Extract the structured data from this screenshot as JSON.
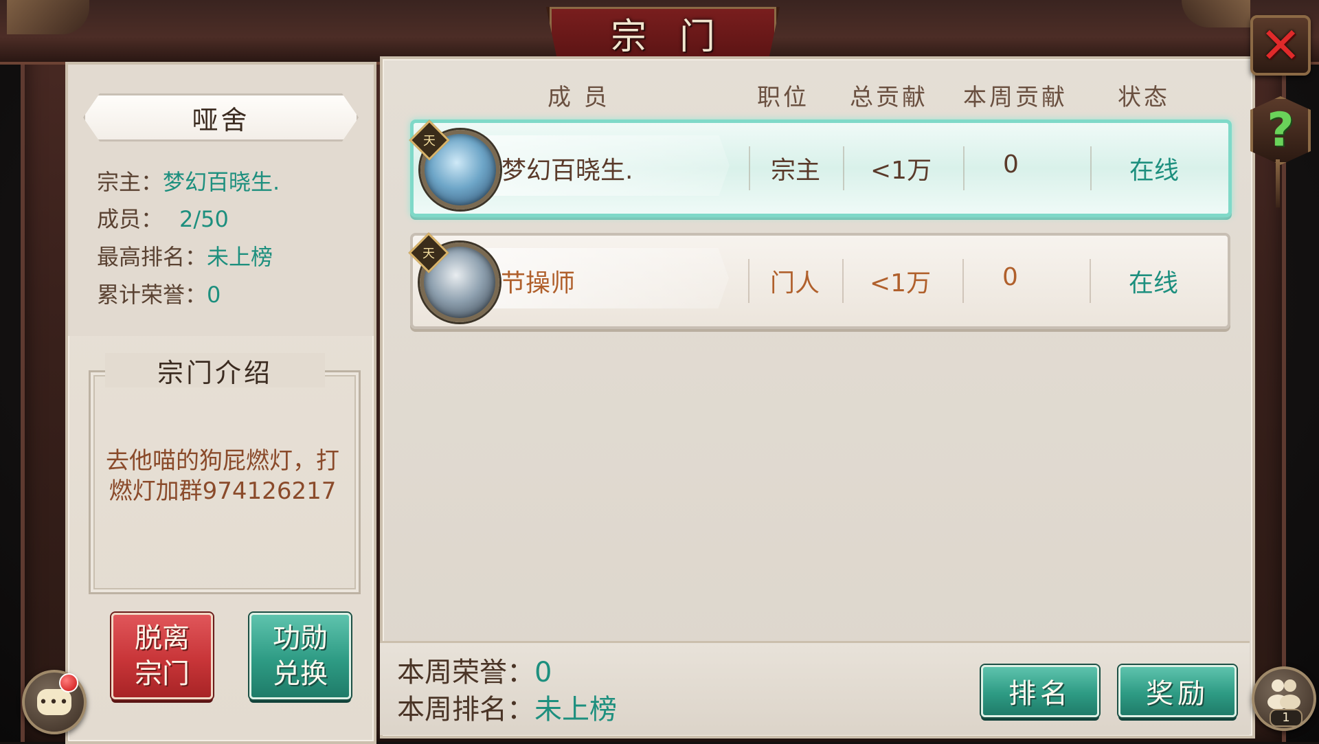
{
  "window": {
    "title": "宗门"
  },
  "guild": {
    "name": "哑舍",
    "leader_label": "宗主：",
    "leader_value": "梦幻百晓生.",
    "members_label": "成员：",
    "members_value": "2/50",
    "best_rank_label": "最高排名：",
    "best_rank_value": "未上榜",
    "honor_label": "累计荣誉：",
    "honor_value": "0"
  },
  "intro": {
    "title": "宗门介绍",
    "text": "去他喵的狗屁燃灯，打燃灯加群974126217"
  },
  "buttons": {
    "leave_line1": "脱离",
    "leave_line2": "宗门",
    "exchange_line1": "功勋",
    "exchange_line2": "兑换",
    "rank": "排名",
    "reward": "奖励"
  },
  "table": {
    "headers": [
      "成 员",
      "职位",
      "总贡献",
      "本周贡献",
      "状态"
    ],
    "rows": [
      {
        "name": "梦幻百晓生.",
        "position": "宗主",
        "total": "<1万",
        "week": "0",
        "status": "在线",
        "badge": "天"
      },
      {
        "name": "节操师",
        "position": "门人",
        "total": "<1万",
        "week": "0",
        "status": "在线",
        "badge": "天"
      }
    ]
  },
  "bottom": {
    "week_honor_label": "本周荣誉：",
    "week_honor_value": "0",
    "week_rank_label": "本周排名：",
    "week_rank_value": "未上榜"
  },
  "icons": {
    "close": "close-icon",
    "help": "help-icon",
    "chat": "chat-icon",
    "friends": "friends-icon"
  },
  "friends": {
    "count": "1"
  },
  "chat": {
    "glyph": "•••"
  },
  "colors": {
    "accent_teal": "#1d8f7e",
    "leave_red": "#c83538",
    "button_green": "#2e9b84",
    "title_red": "#7a1e1e"
  }
}
